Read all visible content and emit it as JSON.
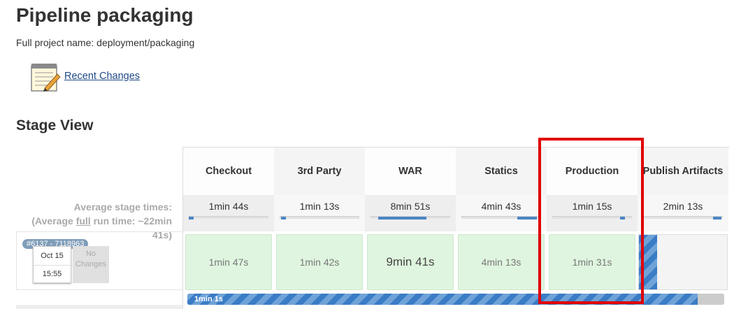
{
  "header": {
    "title": "Pipeline packaging",
    "full_name": "Full project name: deployment/packaging",
    "recent_changes": "Recent Changes"
  },
  "stage_view": {
    "title": "Stage View",
    "avg_label_line1": "Average stage times:",
    "avg_label_line2": "(Average ",
    "avg_label_full": "full",
    "avg_label_line3": " run time: ~22min",
    "avg_label_line4": "41s)",
    "stages": [
      {
        "name": "Checkout",
        "avg": "1min 44s",
        "cell": "1min 47s",
        "bar_pct": 0.05
      },
      {
        "name": "3rd Party",
        "avg": "1min 13s",
        "cell": "1min 42s",
        "bar_pct": 0.05
      },
      {
        "name": "WAR",
        "avg": "8min 51s",
        "cell": "9min 41s",
        "bar_pct": 0.6
      },
      {
        "name": "Statics",
        "avg": "4min 43s",
        "cell": "4min 13s",
        "bar_pct": 0.25
      },
      {
        "name": "Production",
        "avg": "1min 15s",
        "cell": "1min 31s",
        "bar_pct": 0.05
      },
      {
        "name": "Publish Artifacts",
        "avg": "2min 13s",
        "cell": "",
        "bar_pct": 0.1
      }
    ],
    "run": {
      "badge": "#6137 - 7118963",
      "date": "Oct 15",
      "time": "15:55",
      "no_changes": "No Changes"
    },
    "progress": {
      "label": "1min 1s",
      "fraction": 0.95
    }
  },
  "colors": {
    "highlight": "#e00000",
    "success": "#dff5df",
    "progress": "#3a7cc5"
  }
}
